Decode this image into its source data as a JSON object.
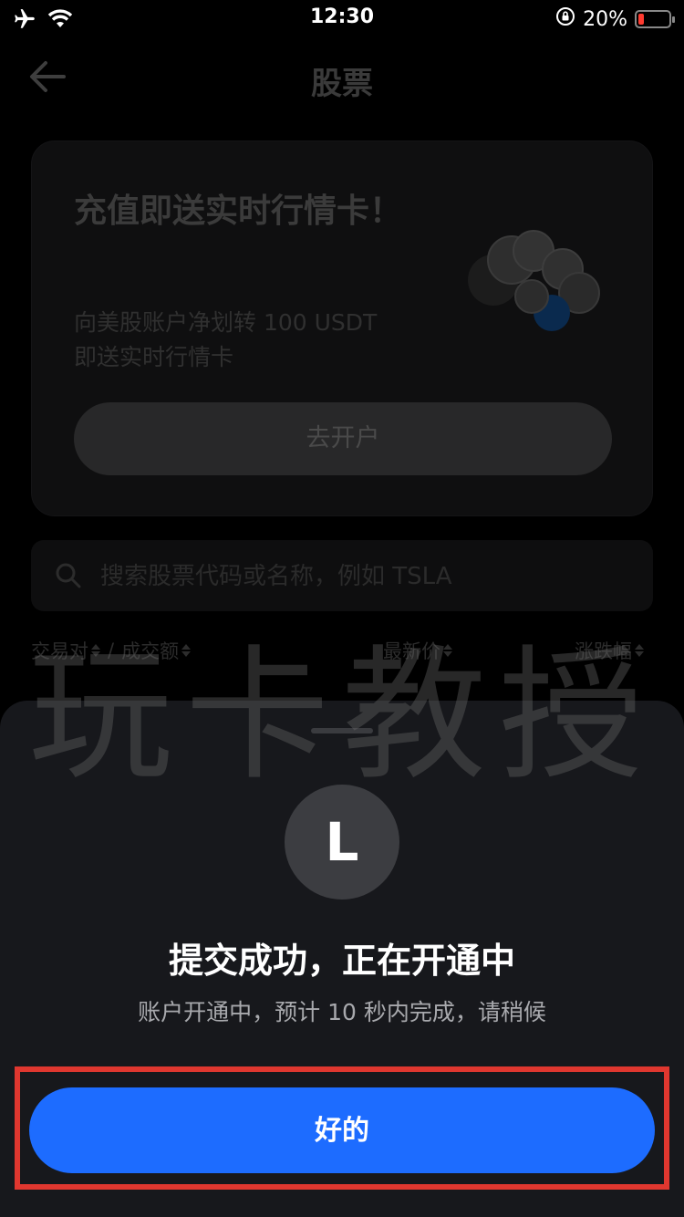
{
  "status_bar": {
    "time": "12:30",
    "battery_percent": "20%",
    "battery_level": 0.2,
    "icons": [
      "airplane-icon",
      "wifi-icon",
      "orientation-lock-icon",
      "battery-icon"
    ]
  },
  "nav": {
    "title": "股票",
    "back_icon": "back-arrow-icon"
  },
  "promo_card": {
    "title": "充值即送实时行情卡！",
    "desc_line1": "向美股账户净划转 100 USDT",
    "desc_line2": "即送实时行情卡",
    "button_label": "去开户",
    "image": "coins-illustration"
  },
  "search": {
    "placeholder": "搜索股票代码或名称，例如 TSLA",
    "value": ""
  },
  "columns": {
    "pair": "交易对",
    "separator": "/",
    "volume": "成交额",
    "price": "最新价",
    "change": "涨跌幅"
  },
  "watermark": "玩卡教授",
  "sheet": {
    "avatar_letter": "L",
    "title": "提交成功，正在开通中",
    "subtitle": "账户开通中，预计 10 秒内完成，请稍候",
    "ok_label": "好的"
  },
  "colors": {
    "accent": "#1d6cff",
    "highlight_border": "#e0372f",
    "sheet_bg": "#17181c",
    "battery_low": "#ff3b30"
  }
}
